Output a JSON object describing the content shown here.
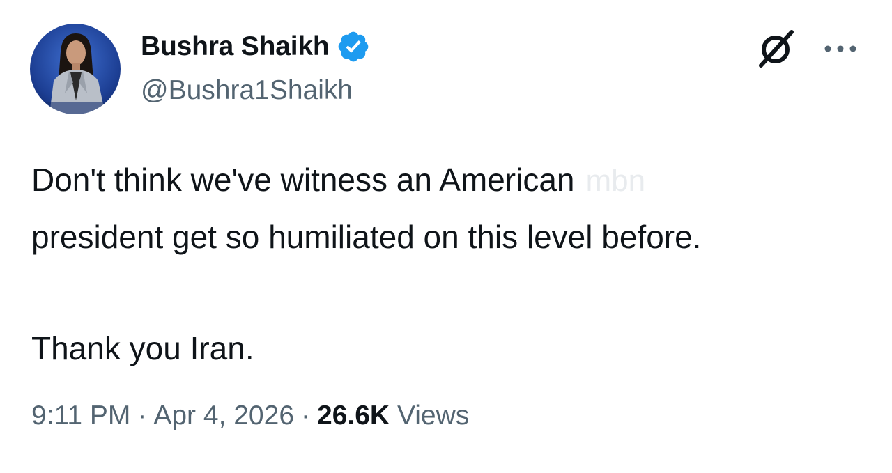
{
  "author": {
    "display_name": "Bushra Shaikh",
    "handle": "@Bushra1Shaikh",
    "verified_icon": "verified-badge-icon",
    "avatar_icon": "profile-photo"
  },
  "actions": {
    "grok_icon": "grok-slash-icon",
    "more_icon": "more-horizontal-icon"
  },
  "tweet": {
    "line1": "Don't think we've witness an American",
    "watermark": "mbn",
    "line2": "president get so humiliated on this level before.",
    "line3": "Thank you Iran."
  },
  "meta": {
    "time": "9:11 PM",
    "separator": "·",
    "date": "Apr 4, 2026",
    "views_count": "26.6K",
    "views_label": "Views"
  },
  "colors": {
    "text_primary": "#0f1419",
    "text_secondary": "#536471",
    "verified_blue": "#1d9bf0"
  }
}
